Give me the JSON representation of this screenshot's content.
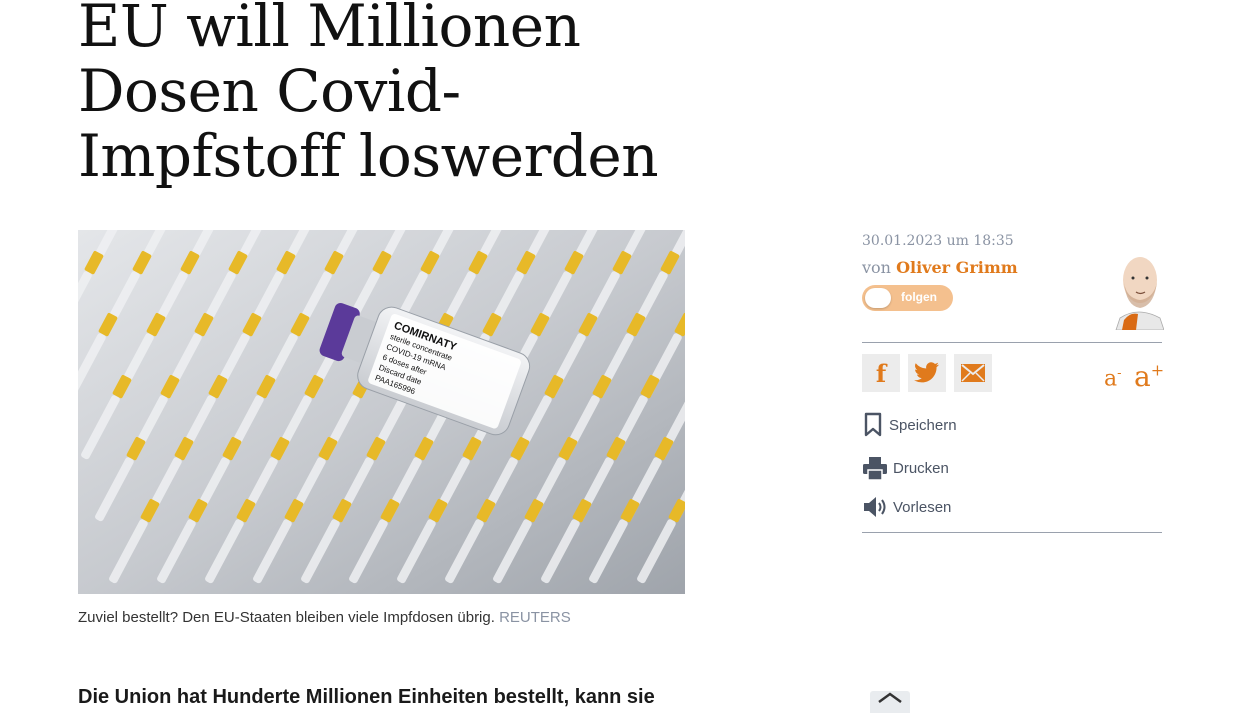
{
  "article": {
    "headline": "EU will Millionen Dosen Covid-Impfstoff loswerden",
    "image_caption": "Zuviel bestellt? Den EU-Staaten bleiben viele Impfdosen übrig.",
    "image_credit": "REUTERS",
    "image_vial_text": [
      "COMIRNATY",
      "sterile concentrate",
      "COVID-19 mRNA",
      "6 doses after",
      "Discard date",
      "PAA165996"
    ],
    "lead": "Die Union hat Hunderte Millionen Einheiten bestellt, kann sie"
  },
  "meta": {
    "date": "30.01.2023 um 18:35",
    "author_prefix": "von",
    "author_name": "Oliver Grimm",
    "follow_label": "folgen"
  },
  "share": {
    "facebook_glyph": "f",
    "icons": [
      "facebook-icon",
      "twitter-icon",
      "email-icon"
    ]
  },
  "font_size": {
    "decrease_label": "a",
    "decrease_sup": "-",
    "increase_label": "a",
    "increase_sup": "+"
  },
  "actions": {
    "save": "Speichern",
    "print": "Drucken",
    "read_aloud": "Vorlesen"
  },
  "colors": {
    "accent": "#e07a1c",
    "muted": "#8a93a3",
    "action_text": "#4b5464",
    "follow_bg": "#f4c08e"
  }
}
